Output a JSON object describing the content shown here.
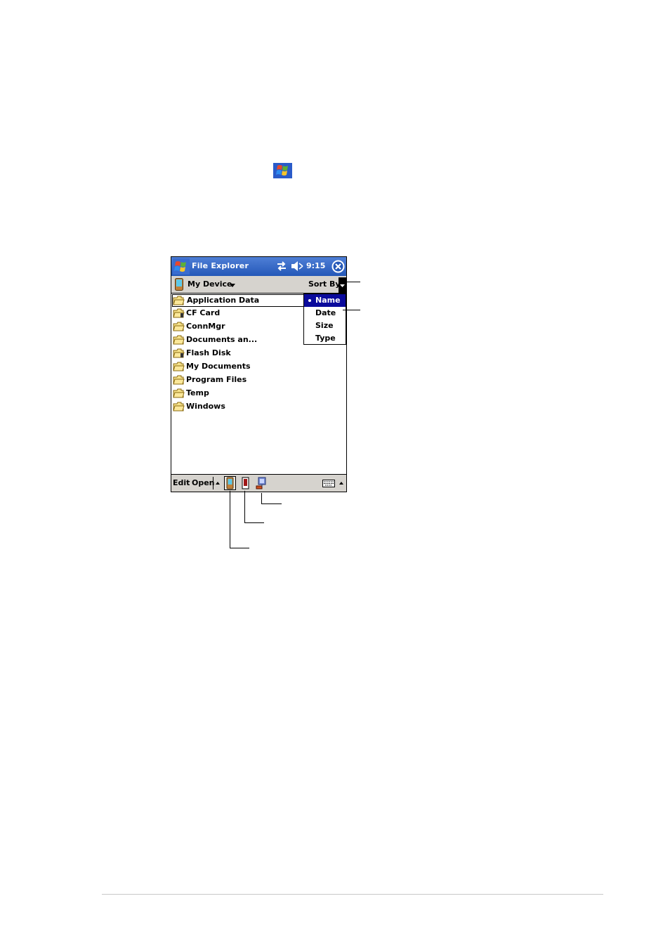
{
  "window": {
    "title": "File Explorer",
    "clock": "9:15"
  },
  "location": {
    "current": "My Device",
    "sort_label": "Sort By"
  },
  "files": [
    {
      "name": "Application Data",
      "icon": "folder-icon",
      "selected": true
    },
    {
      "name": "CF Card",
      "icon": "storage-card-folder-icon"
    },
    {
      "name": "ConnMgr",
      "icon": "folder-icon"
    },
    {
      "name": "Documents an...",
      "icon": "folder-icon"
    },
    {
      "name": "Flash Disk",
      "icon": "storage-card-folder-icon"
    },
    {
      "name": "My Documents",
      "icon": "folder-icon"
    },
    {
      "name": "Program Files",
      "icon": "folder-icon"
    },
    {
      "name": "Temp",
      "icon": "folder-icon"
    },
    {
      "name": "Windows",
      "icon": "folder-icon"
    }
  ],
  "sort_menu": {
    "options": [
      "Name",
      "Date",
      "Size",
      "Type"
    ],
    "checked": "Name"
  },
  "command_bar": {
    "edit": "Edit",
    "open": "Open"
  },
  "colors": {
    "title_bar": "#2458b8",
    "menu_highlight": "#0a0a9c",
    "bar_gray": "#d6d3ce"
  }
}
